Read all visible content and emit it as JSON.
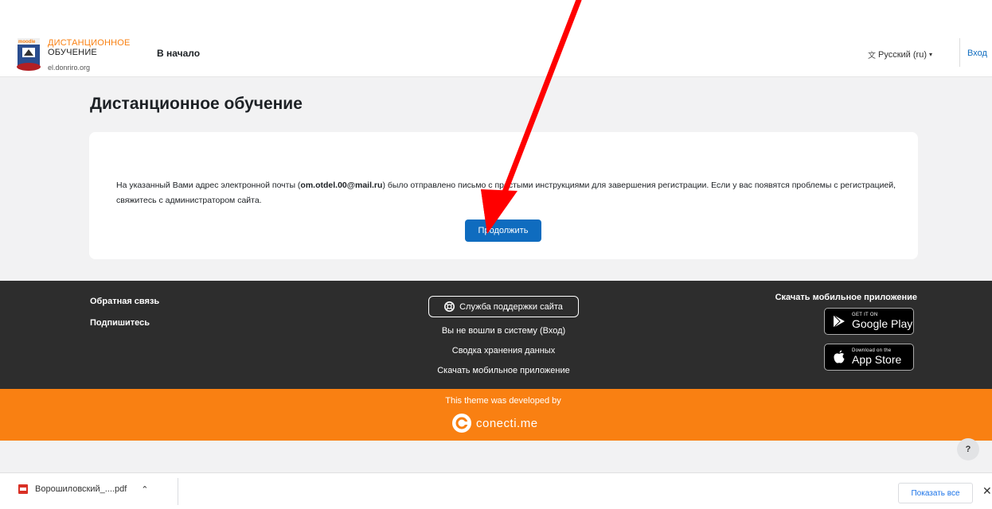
{
  "header": {
    "brand_line1": "ДИСТАНЦИОННОЕ",
    "brand_line2": "ОБУЧЕНИЕ",
    "brand_site": "el.donriro.org",
    "logo_badge_text": "moodle",
    "nav_home": "В начало",
    "language": "Русский (ru)",
    "login": "Вход"
  },
  "main": {
    "page_title": "Дистанционное обучение",
    "message_before": "На указанный Вами адрес электронной почты (",
    "email": "om.otdel.00@mail.ru",
    "message_after": ") было отправлено письмо с простыми инструкциями для завершения регистрации. Если у вас появятся проблемы с регистрацией, свяжитесь с администратором сайта.",
    "continue_label": "Продолжить"
  },
  "annotation": {
    "arrow_color": "#ff0000"
  },
  "footer": {
    "feedback": "Обратная связь",
    "subscribe": "Подпишитесь",
    "support_button": "Служба поддержки сайта",
    "not_logged_in": "Вы не вошли в систему (Вход)",
    "data_retention": "Сводка хранения данных",
    "get_mobile_app": "Скачать мобильное приложение",
    "mobile_title": "Скачать мобильное приложение",
    "google_play_small": "GET IT ON",
    "google_play_big": "Google Play",
    "app_store_small": "Download on the",
    "app_store_big": "App Store"
  },
  "theme_bar": {
    "developed_by": "This theme was developed by",
    "brand": "conecti.me"
  },
  "help_label": "?",
  "download_bar": {
    "file_name": "Ворошиловский_....pdf",
    "show_all": "Показать все",
    "close": "✕"
  },
  "colors": {
    "accent_blue": "#0f6cbf",
    "brand_orange": "#f98012",
    "footer_dark": "#2d2d2d"
  }
}
